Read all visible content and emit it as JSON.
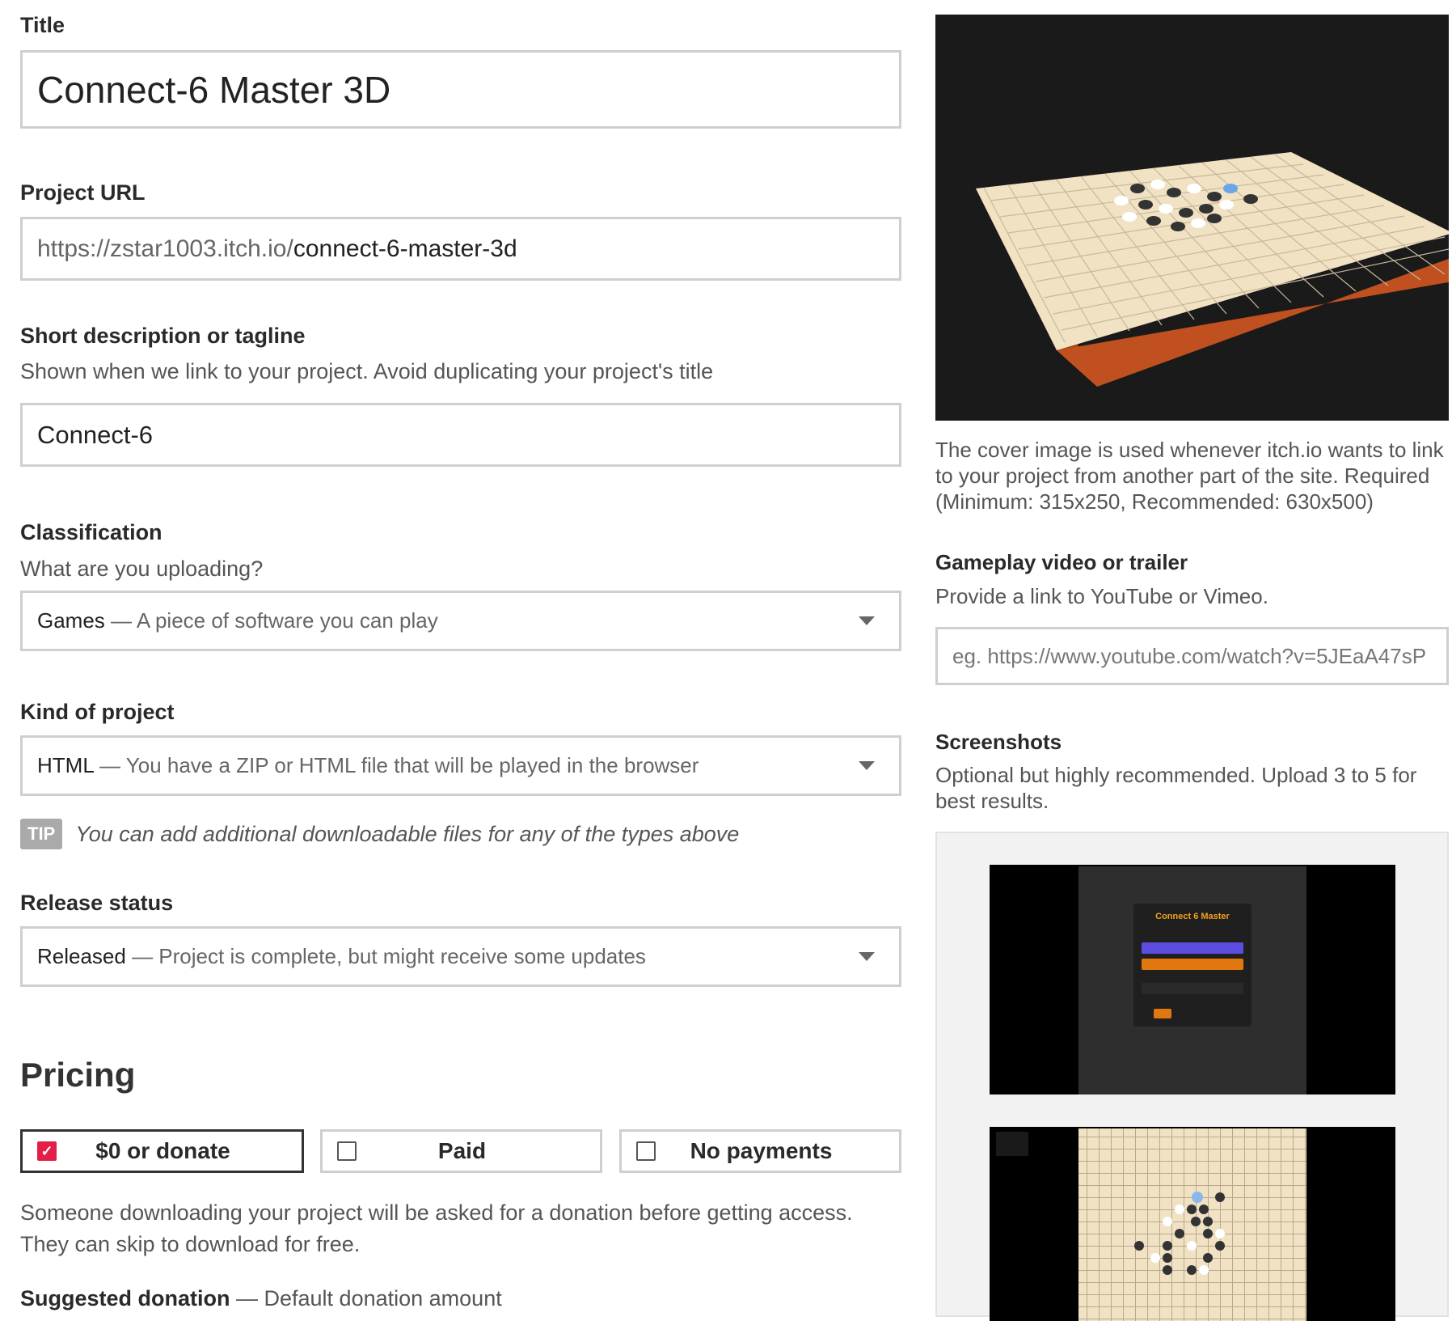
{
  "title": {
    "label": "Title",
    "value": "Connect-6 Master 3D"
  },
  "project_url": {
    "label": "Project URL",
    "prefix": "https://zstar1003.itch.io/",
    "slug": "connect-6-master-3d"
  },
  "tagline": {
    "label": "Short description or tagline",
    "hint": "Shown when we link to your project. Avoid duplicating your project's title",
    "value": "Connect-6"
  },
  "classification": {
    "label": "Classification",
    "hint": "What are you uploading?",
    "selected_main": "Games",
    "selected_desc": " — A piece of software you can play"
  },
  "kind": {
    "label": "Kind of project",
    "selected_main": "HTML",
    "selected_desc": " — You have a ZIP or HTML file that will be played in the browser"
  },
  "tip": {
    "badge": "TIP",
    "text": "You can add additional downloadable files for any of the types above"
  },
  "release": {
    "label": "Release status",
    "selected_main": "Released",
    "selected_desc": " — Project is complete, but might receive some updates"
  },
  "pricing": {
    "heading": "Pricing",
    "options": [
      {
        "label": "$0 or donate",
        "checked": true
      },
      {
        "label": "Paid",
        "checked": false
      },
      {
        "label": "No payments",
        "checked": false
      }
    ],
    "description_line1": "Someone downloading your project will be asked for a donation before getting access.",
    "description_line2": "They can skip to download for free.",
    "suggested_label": "Suggested donation",
    "suggested_hint": " — Default donation amount"
  },
  "cover": {
    "note_line1": "The cover image is used whenever itch.io wants to link",
    "note_line2": "to your project from another part of the site. Required",
    "note_line3": "(Minimum: 315x250, Recommended: 630x500)"
  },
  "video": {
    "label": "Gameplay video or trailer",
    "hint": "Provide a link to YouTube or Vimeo.",
    "placeholder": "eg. https://www.youtube.com/watch?v=5JEaA47sP"
  },
  "screenshots": {
    "label": "Screenshots",
    "hint_line1": "Optional but highly recommended. Upload 3 to 5 for",
    "hint_line2": "best results.",
    "shot1_title": "Connect 6 Master"
  },
  "icons": {
    "check": "check-icon",
    "caret": "chevron-down-icon"
  }
}
